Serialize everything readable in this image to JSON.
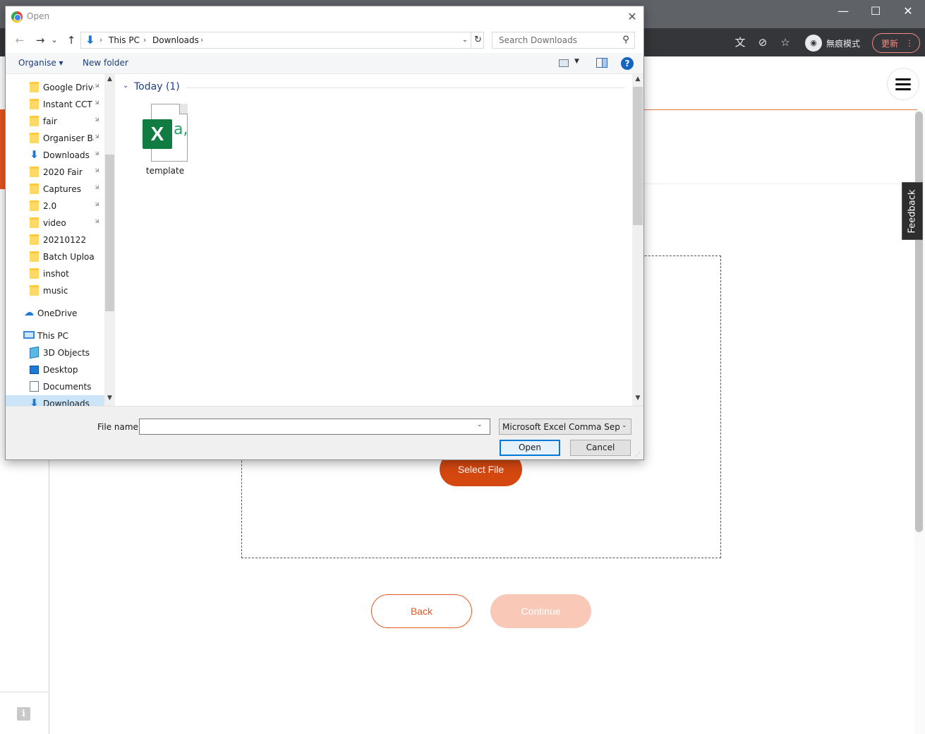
{
  "browser": {
    "minimize_glyph": "—",
    "maximize_glyph": "☐",
    "close_glyph": "✕",
    "incognito_label": "無痕模式",
    "update_label": "更新",
    "update_menu_glyph": "⋮",
    "translate_glyph": "文",
    "eye_off_glyph": "⊘",
    "star_glyph": "☆"
  },
  "page": {
    "feedback_label": "Feedback",
    "select_file_label": "Select File",
    "back_label": "Back",
    "continue_label": "Continue",
    "info_glyph": "i",
    "accent_color": "#d4470f"
  },
  "dialog": {
    "title": "Open",
    "close_glyph": "✕",
    "nav": {
      "back_glyph": "←",
      "forward_glyph": "→",
      "recent_glyph": "⌄",
      "up_glyph": "↑"
    },
    "breadcrumbs": [
      "This PC",
      "Downloads"
    ],
    "crumb_sep": "›",
    "refresh_glyph": "↻",
    "dropdown_glyph": "⌄",
    "search_placeholder": "Search Downloads",
    "search_glyph": "⚲",
    "command_bar": {
      "organise_label": "Organise ▾",
      "new_folder_label": "New folder",
      "view_arrow": "▼",
      "help_glyph": "?"
    },
    "nav_pane": {
      "pin_glyph": "📌",
      "quick_access": [
        {
          "label": "Google Drive",
          "icon": "folder"
        },
        {
          "label": "Instant CCT",
          "icon": "folder"
        },
        {
          "label": "fair",
          "icon": "folder"
        },
        {
          "label": "Organiser Bac",
          "icon": "folder"
        },
        {
          "label": "Downloads",
          "icon": "download"
        },
        {
          "label": "2020 Fair",
          "icon": "folder"
        },
        {
          "label": "Captures",
          "icon": "folder"
        },
        {
          "label": "2.0",
          "icon": "folder"
        },
        {
          "label": "video",
          "icon": "folder"
        },
        {
          "label": "20210122",
          "icon": "folder"
        },
        {
          "label": "Batch Upload",
          "icon": "folder"
        },
        {
          "label": "inshot",
          "icon": "folder"
        },
        {
          "label": "music",
          "icon": "folder"
        }
      ],
      "onedrive_label": "OneDrive",
      "this_pc_label": "This PC",
      "this_pc_items": [
        {
          "label": "3D Objects",
          "icon": "cube"
        },
        {
          "label": "Desktop",
          "icon": "desktop"
        },
        {
          "label": "Documents",
          "icon": "document"
        },
        {
          "label": "Downloads",
          "icon": "download"
        }
      ],
      "scroll_up": "▲",
      "scroll_down": "▼"
    },
    "content": {
      "group_label": "Today (1)",
      "group_chevron": "⌄",
      "files": [
        {
          "name": "template",
          "icon": "excel-csv"
        }
      ],
      "excel_letter": "X",
      "excel_suffix": "a,",
      "scroll_up": "▲",
      "scroll_down": "▼"
    },
    "footer": {
      "file_name_label": "File name:",
      "file_name_value": "",
      "file_type_value": "Microsoft Excel Comma Separated Values File",
      "combo_arrow": "⌄",
      "open_label": "Open",
      "cancel_label": "Cancel",
      "grip_glyph": "⋰"
    }
  }
}
